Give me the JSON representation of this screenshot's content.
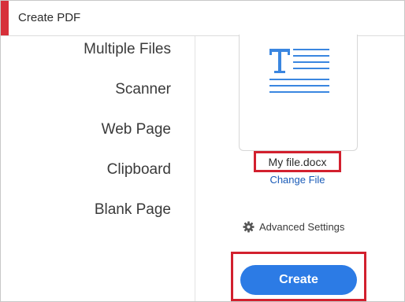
{
  "window": {
    "title": "Create PDF",
    "accent_color": "#d7303a"
  },
  "sidebar": {
    "items": [
      {
        "label": "Multiple Files"
      },
      {
        "label": "Scanner"
      },
      {
        "label": "Web Page"
      },
      {
        "label": "Clipboard"
      },
      {
        "label": "Blank Page"
      }
    ]
  },
  "main": {
    "file_icon": "word-document-icon",
    "file_name": "My file.docx",
    "change_file_label": "Change File",
    "advanced_settings_label": "Advanced Settings",
    "advanced_settings_icon": "gear-icon",
    "create_label": "Create",
    "button_color": "#2c7be5",
    "highlight_color": "#d2202e",
    "link_color": "#1a5bb8"
  }
}
